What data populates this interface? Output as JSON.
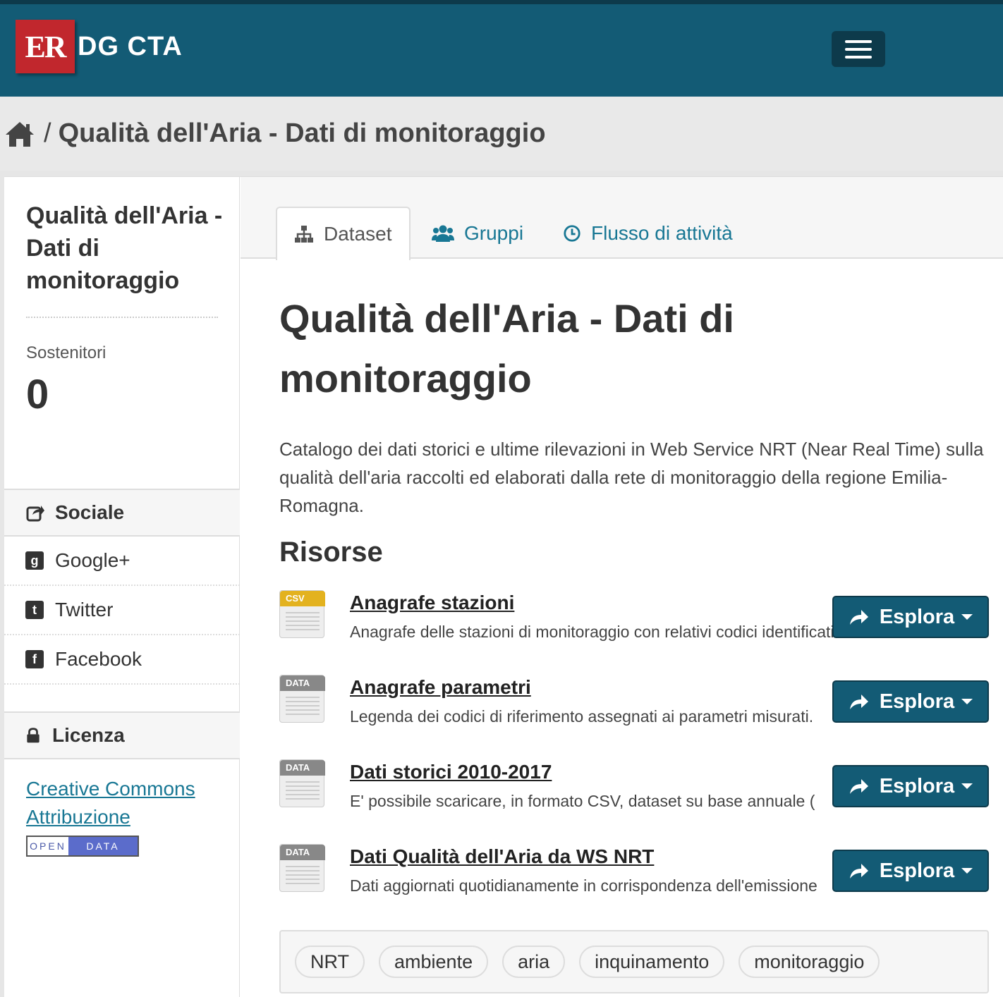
{
  "header": {
    "logo_mark": "ER",
    "site_name": "DG CTA",
    "menu_icon": "hamburger-icon"
  },
  "breadcrumb": {
    "home_icon": "home-icon",
    "separator": "/",
    "current": "Qualità dell'Aria - Dati di monitoraggio"
  },
  "sidebar": {
    "title": "Qualità dell'Aria - Dati di monitoraggio",
    "followers_label": "Sostenitori",
    "followers_count": "0",
    "social": {
      "heading": "Sociale",
      "heading_icon": "share-square-icon",
      "items": [
        {
          "label": "Google+",
          "icon": "google-plus-icon"
        },
        {
          "label": "Twitter",
          "icon": "twitter-icon"
        },
        {
          "label": "Facebook",
          "icon": "facebook-icon"
        }
      ]
    },
    "license": {
      "heading": "Licenza",
      "heading_icon": "lock-icon",
      "link": "Creative Commons Attribuzione",
      "badge": {
        "left": "OPEN",
        "right": "DATA"
      }
    }
  },
  "tabs": [
    {
      "label": "Dataset",
      "icon": "sitemap-icon",
      "active": true
    },
    {
      "label": "Gruppi",
      "icon": "users-icon",
      "active": false
    },
    {
      "label": "Flusso di attività",
      "icon": "clock-icon",
      "active": false
    }
  ],
  "dataset": {
    "title": "Qualità dell'Aria - Dati di monitoraggio",
    "notes": "Catalogo dei dati storici e ultime rilevazioni in Web Service NRT (Near Real Time) sulla qualità dell'aria raccolti ed elaborati dalla rete di monitoraggio della regione Emilia-Romagna.",
    "resources_heading": "Risorse",
    "explore_label": "Esplora",
    "resources": [
      {
        "format": "CSV",
        "title": "Anagrafe stazioni",
        "description": "Anagrafe delle stazioni di monitoraggio con relativi codici identificativi"
      },
      {
        "format": "DATA",
        "title": "Anagrafe parametri",
        "description": "Legenda dei codici di riferimento assegnati ai parametri misurati."
      },
      {
        "format": "DATA",
        "title": "Dati storici 2010-2017",
        "description": "E' possibile scaricare, in formato CSV, dataset su base annuale ("
      },
      {
        "format": "DATA",
        "title": "Dati Qualità dell'Aria da WS NRT",
        "description": "Dati aggiornati quotidianamente in corrispondenza dell'emissione"
      }
    ],
    "tags": [
      "NRT",
      "ambiente",
      "aria",
      "inquinamento",
      "monitoraggio"
    ]
  },
  "colors": {
    "header_bg": "#135b75",
    "logo_red": "#c1272d",
    "link": "#187794",
    "button_bg": "#135b75"
  }
}
